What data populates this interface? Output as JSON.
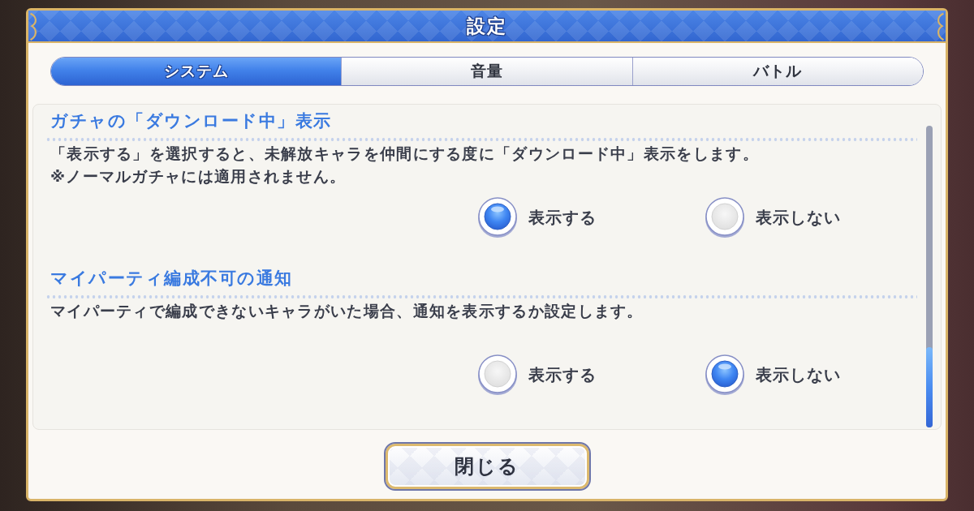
{
  "window": {
    "title": "設定"
  },
  "tabs": [
    {
      "label": "システム",
      "selected": true
    },
    {
      "label": "音量",
      "selected": false
    },
    {
      "label": "バトル",
      "selected": false
    }
  ],
  "settings": [
    {
      "heading": "ガチャの「ダウンロード中」表示",
      "description": [
        "「表示する」を選択すると、未解放キャラを仲間にする度に「ダウンロード中」表示をします。",
        "※ノーマルガチャには適用されません。"
      ],
      "options": [
        {
          "label": "表示する",
          "selected": true
        },
        {
          "label": "表示しない",
          "selected": false
        }
      ]
    },
    {
      "heading": "マイパーティ編成不可の通知",
      "description": [
        "マイパーティで編成できないキャラがいた場合、通知を表示するか設定します。"
      ],
      "options": [
        {
          "label": "表示する",
          "selected": false
        },
        {
          "label": "表示しない",
          "selected": true
        }
      ]
    }
  ],
  "buttons": [
    "閉じる"
  ]
}
